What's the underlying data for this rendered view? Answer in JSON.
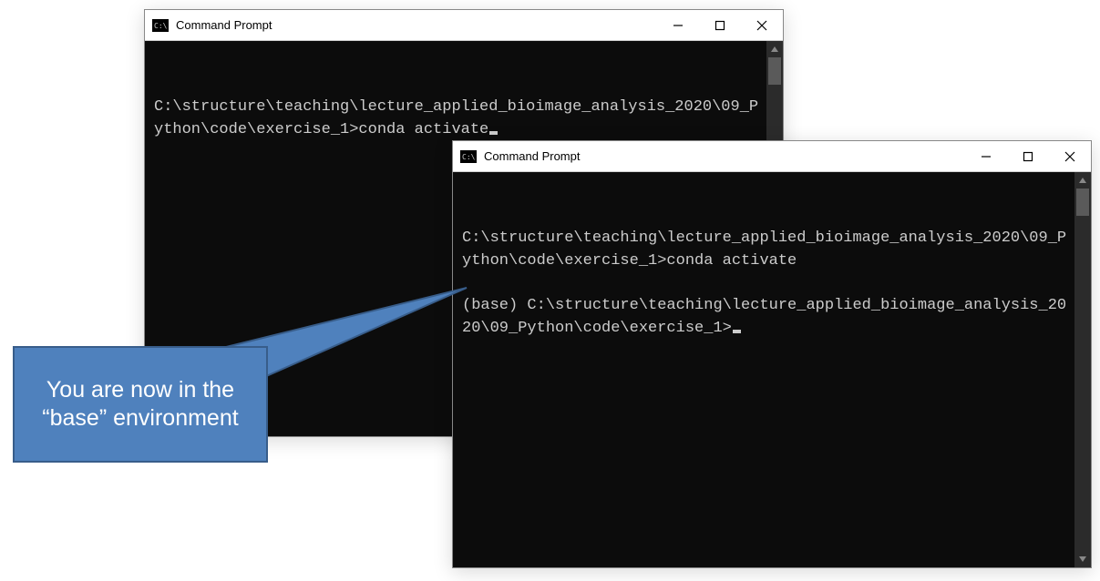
{
  "window1": {
    "title": "Command Prompt",
    "lines": "\nC:\\structure\\teaching\\lecture_applied_bioimage_analysis_2020\\09_Python\\code\\exercise_1>conda activate"
  },
  "window2": {
    "title": "Command Prompt",
    "lines": "\nC:\\structure\\teaching\\lecture_applied_bioimage_analysis_2020\\09_Python\\code\\exercise_1>conda activate\n\n(base) C:\\structure\\teaching\\lecture_applied_bioimage_analysis_2020\\09_Python\\code\\exercise_1>"
  },
  "callout": {
    "text": "You are now in the “base” environment"
  },
  "controls": {
    "minimize": "–",
    "close": "✕"
  }
}
